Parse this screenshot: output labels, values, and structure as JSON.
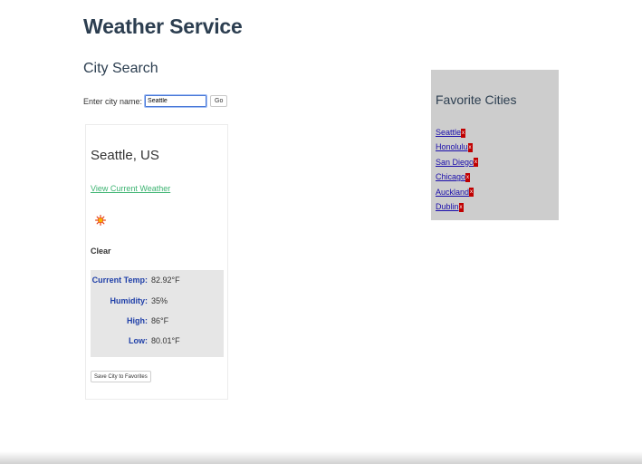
{
  "app": {
    "title": "Weather Service"
  },
  "search": {
    "section_title": "City Search",
    "label": "Enter city name:",
    "value": "Seattle",
    "go_label": "Go"
  },
  "weather": {
    "city": "Seattle, US",
    "link_label": "View Current Weather",
    "icon": "sun-icon",
    "condition": "Clear",
    "details": [
      {
        "label": "Current Temp:",
        "value": "82.92°F"
      },
      {
        "label": "Humidity:",
        "value": "35%"
      },
      {
        "label": "High:",
        "value": "86°F"
      },
      {
        "label": "Low:",
        "value": "80.01°F"
      }
    ],
    "save_label": "Save City to Favorites"
  },
  "favorites": {
    "title": "Favorite Cities",
    "remove_label": "x",
    "items": [
      "Seattle",
      "Honolulu",
      "San Diego",
      "Chicago",
      "Auckland",
      "Dublin"
    ]
  },
  "colors": {
    "accent_link": "#3cb371",
    "label_blue": "#1f3fa8",
    "remove_red": "#c00000",
    "panel_gray": "#cdcdcd"
  }
}
